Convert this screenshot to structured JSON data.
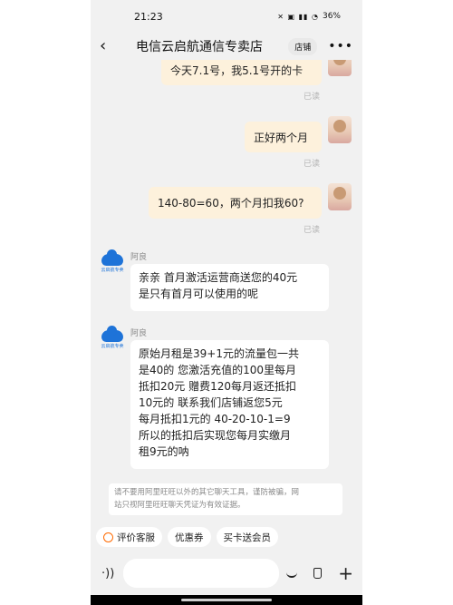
{
  "status_bar": {
    "time": "21:23",
    "icons": "✕ ▣ ▮▮ ◔",
    "battery": "36%"
  },
  "nav": {
    "back_icon": "chevron-left",
    "title": "电信云启航通信专卖店",
    "shop_button": "店铺",
    "more_icon": "•••"
  },
  "messages_out": [
    {
      "text": "今天7.1号，我5.1号开的卡",
      "status": "已读"
    },
    {
      "text": "正好两个月",
      "status": "已读"
    },
    {
      "text": "140-80=60，两个月扣我60?",
      "status": "已读"
    }
  ],
  "messages_in": [
    {
      "sender": "阿良",
      "avatar_caption": "云启航专卖",
      "lines": [
        "亲亲  首月激活运营商送您的40元",
        "是只有首月可以使用的呢"
      ]
    },
    {
      "sender": "阿良",
      "avatar_caption": "云启航专卖",
      "lines": [
        "原始月租是39+1元的流量包一共",
        "是40的  您激活充值的100里每月",
        "抵扣20元    赠费120每月返还抵扣",
        "10元的       联系我们店铺返您5元",
        "每月抵扣1元的       40-20-10-1=9",
        "所以的抵扣后实现您每月实缴月",
        "租9元的呐"
      ]
    }
  ],
  "notice": {
    "line1": "请不要用阿里旺旺以外的其它聊天工具，谨防被骗，网",
    "line2": "站只视阿里旺旺聊天凭证为有效证据。"
  },
  "quick_actions": {
    "rate": "评价客服",
    "coupon": "优惠券",
    "offer": "买卡送会员"
  },
  "input": {
    "placeholder": ""
  },
  "colors": {
    "outgoing_bubble": "#fdf1dc",
    "incoming_bubble": "#ffffff",
    "background": "#f1f1f1",
    "brand_blue": "#1e73d8",
    "accent_orange": "#ff6a00"
  }
}
